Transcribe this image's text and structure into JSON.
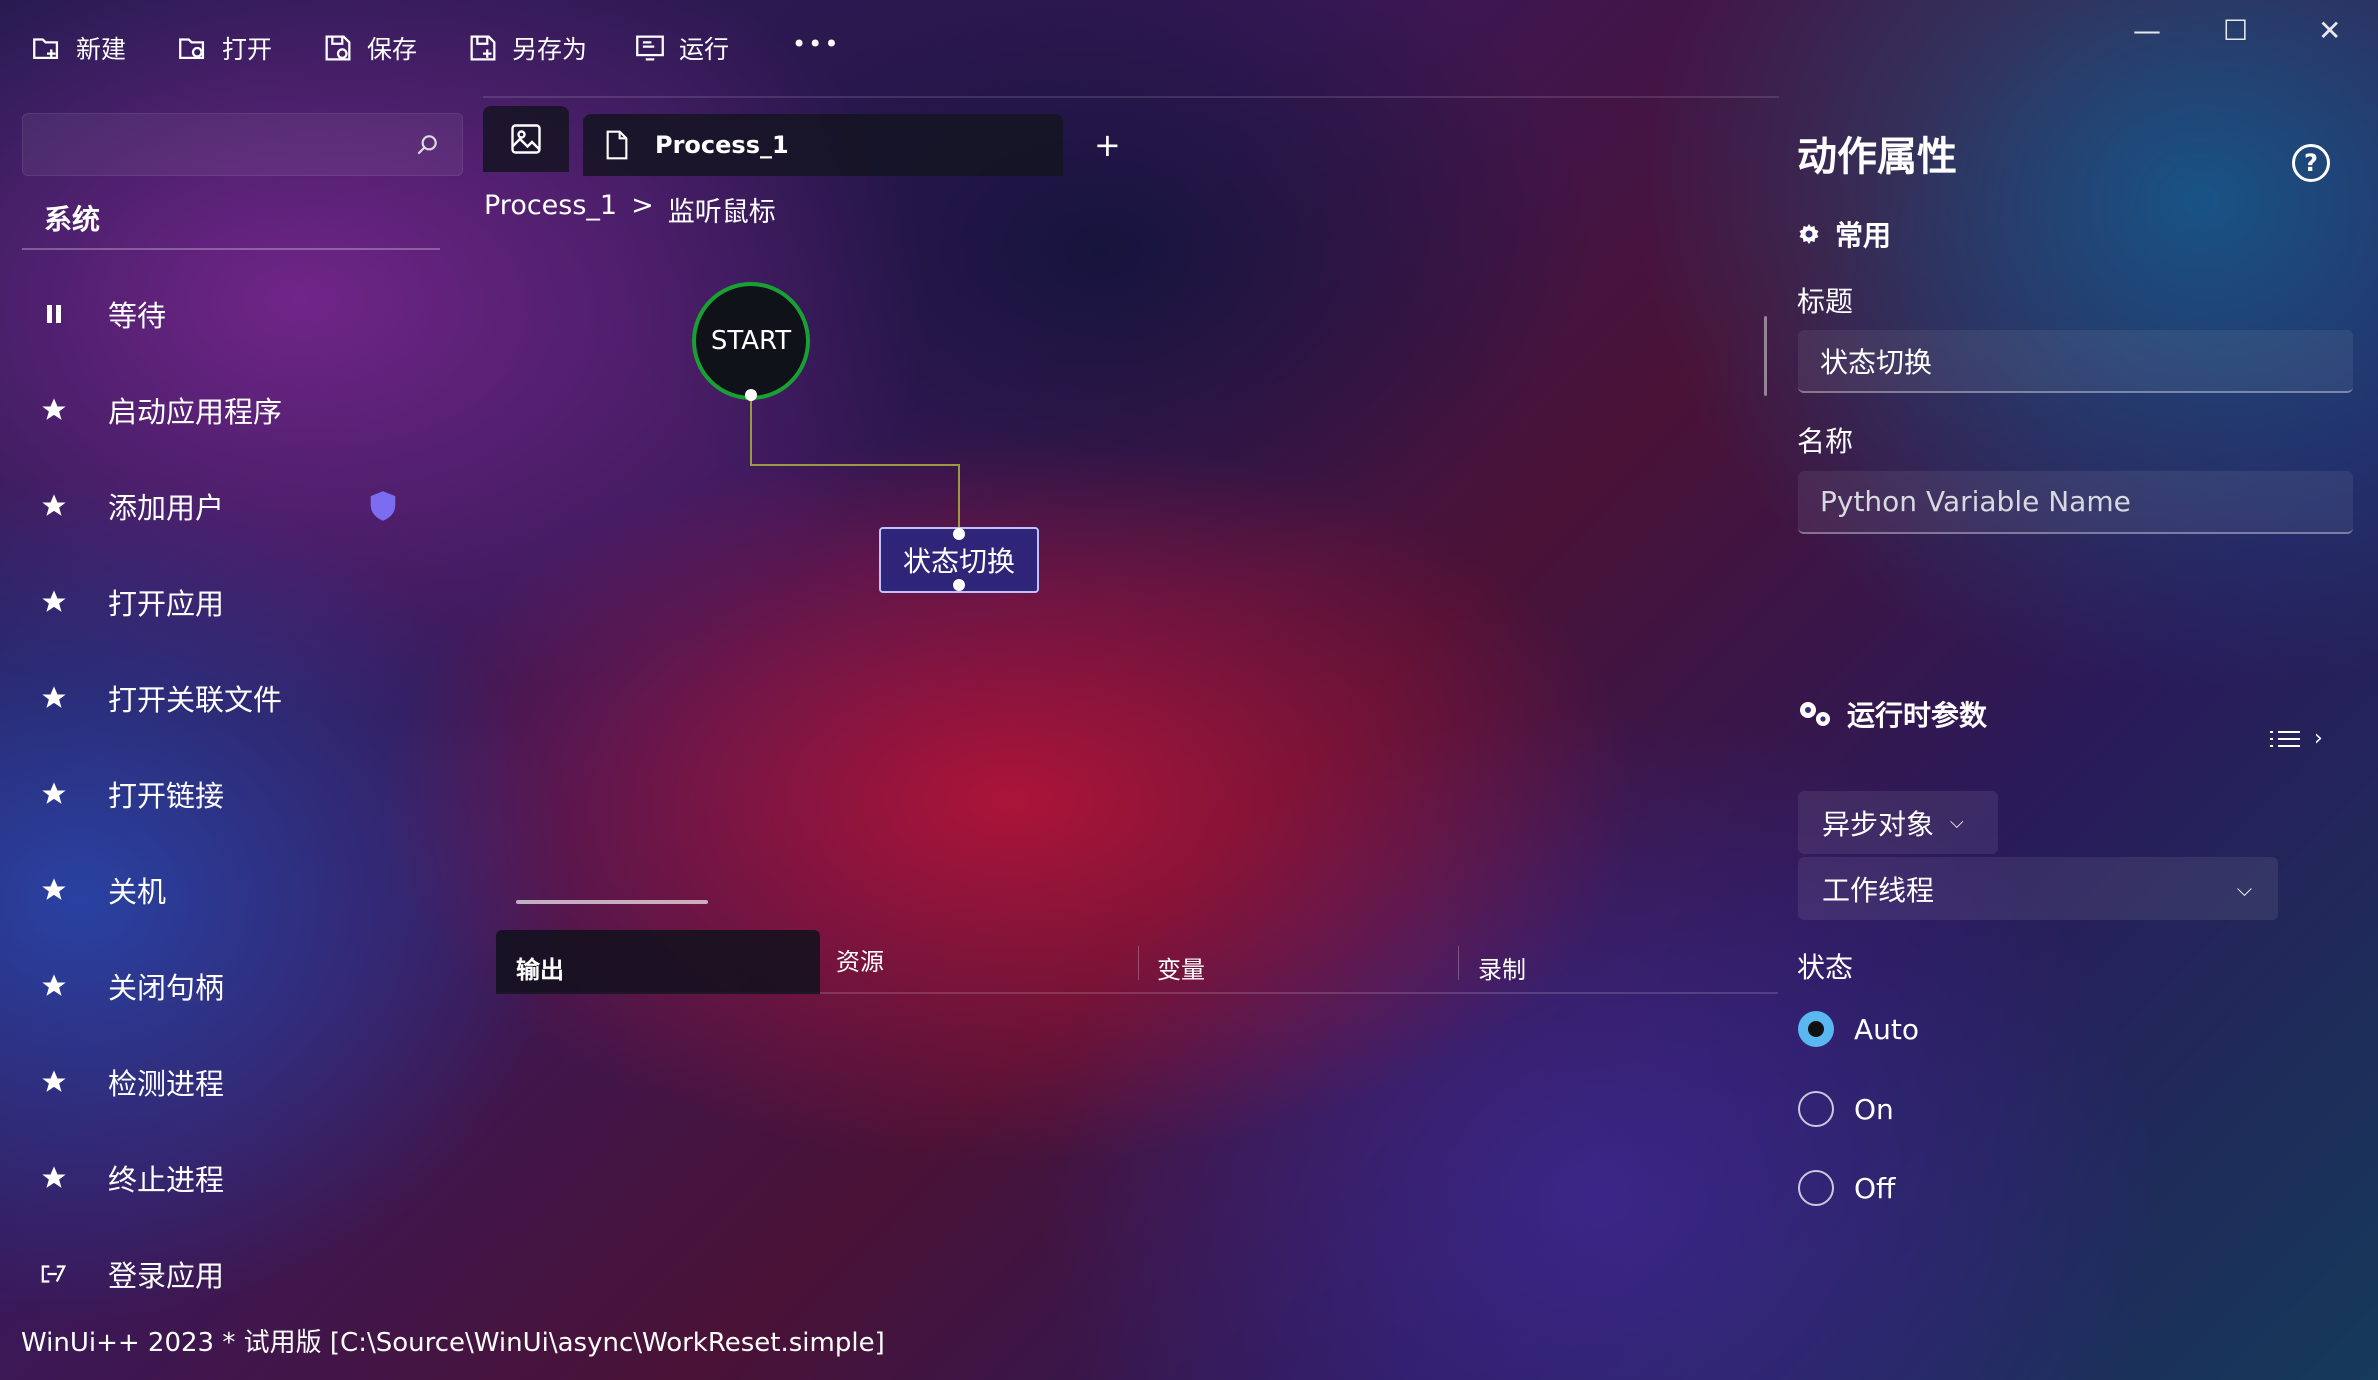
{
  "toolbar": {
    "new_label": "新建",
    "open_label": "打开",
    "save_label": "保存",
    "save_as_label": "另存为",
    "run_label": "运行",
    "more_label": "•••"
  },
  "window_controls": {
    "minimize": "—",
    "maximize": "☐",
    "close": "✕"
  },
  "sidebar": {
    "section_title": "系统",
    "items": [
      {
        "label": "等待",
        "icon": "pause-icon"
      },
      {
        "label": "启动应用程序",
        "icon": "star-icon"
      },
      {
        "label": "添加用户",
        "icon": "star-icon",
        "badge": "shield-icon"
      },
      {
        "label": "打开应用",
        "icon": "star-icon"
      },
      {
        "label": "打开关联文件",
        "icon": "star-icon"
      },
      {
        "label": "打开链接",
        "icon": "star-icon"
      },
      {
        "label": "关机",
        "icon": "star-icon"
      },
      {
        "label": "关闭句柄",
        "icon": "star-icon"
      },
      {
        "label": "检测进程",
        "icon": "star-icon"
      },
      {
        "label": "终止进程",
        "icon": "star-icon"
      },
      {
        "label": "登录应用",
        "icon": "login-icon"
      }
    ]
  },
  "tabs": {
    "active_label": "Process_1",
    "add_label": "+"
  },
  "breadcrumb": {
    "root": "Process_1",
    "separator": ">",
    "current": "监听鼠标"
  },
  "canvas": {
    "start_label": "START",
    "node_label": "状态切换"
  },
  "bottom_tabs": [
    "输出",
    "资源",
    "变量",
    "录制"
  ],
  "properties": {
    "title": "动作属性",
    "help": "?",
    "common_section": "常用",
    "title_label": "标题",
    "title_value": "状态切换",
    "name_label": "名称",
    "name_placeholder": "Python Variable Name",
    "runtime_section": "运行时参数",
    "async_label": "异步对象",
    "thread_value": "工作线程",
    "state_label": "状态",
    "state_options": [
      "Auto",
      "On",
      "Off"
    ],
    "state_selected": "Auto"
  },
  "status_bar": "WinUi++ 2023 * 试用版 [C:\\Source\\WinUi\\async\\WorkReset.simple]",
  "colors": {
    "accent": "#5ab8f0",
    "start_border": "#18a032",
    "node_border": "#c0c0ff",
    "shield": "#7c6cf0"
  }
}
